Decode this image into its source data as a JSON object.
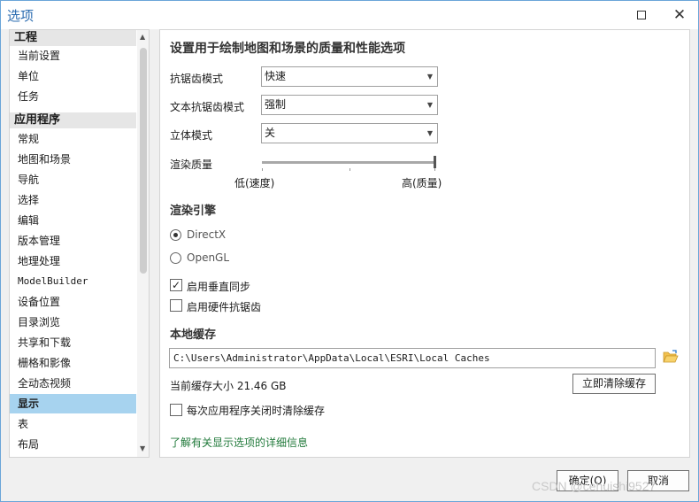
{
  "window": {
    "title": "选项"
  },
  "nav": {
    "groups": [
      {
        "label": "工程",
        "items": [
          "当前设置",
          "单位",
          "任务"
        ]
      },
      {
        "label": "应用程序",
        "items": [
          "常规",
          "地图和场景",
          "导航",
          "选择",
          "编辑",
          "版本管理",
          "地理处理",
          "ModelBuilder",
          "设备位置",
          "目录浏览",
          "共享和下载",
          "栅格和影像",
          "全动态视频",
          "显示",
          "表",
          "布局"
        ]
      }
    ],
    "active": "显示"
  },
  "panel": {
    "heading": "设置用于绘制地图和场景的质量和性能选项",
    "antialias": {
      "label": "抗锯齿模式",
      "value": "快速"
    },
    "text_antialias": {
      "label": "文本抗锯齿模式",
      "value": "强制"
    },
    "stereo": {
      "label": "立体模式",
      "value": "关"
    },
    "quality": {
      "label": "渲染质量",
      "low": "低(速度)",
      "high": "高(质量)",
      "level": 1.0
    },
    "engine": {
      "label": "渲染引擎",
      "options": [
        "DirectX",
        "OpenGL"
      ],
      "selected": "DirectX"
    },
    "vsync": {
      "label": "启用垂直同步",
      "checked": true
    },
    "hw_aa": {
      "label": "启用硬件抗锯齿",
      "checked": false
    },
    "cache": {
      "label": "本地缓存",
      "path": "C:\\Users\\Administrator\\AppData\\Local\\ESRI\\Local Caches",
      "size_text": "当前缓存大小 21.46 GB",
      "clear_button": "立即清除缓存",
      "clear_on_close": {
        "label": "每次应用程序关闭时清除缓存",
        "checked": false
      }
    },
    "learn_more": "了解有关显示选项的详细信息"
  },
  "footer": {
    "ok": "确定(O)",
    "cancel": "取消"
  },
  "watermark": "CSDN @cehuishi9527",
  "colors": {
    "accent": "#2b6cb0",
    "active_item": "#a7d3ef",
    "link": "#217a3b"
  }
}
